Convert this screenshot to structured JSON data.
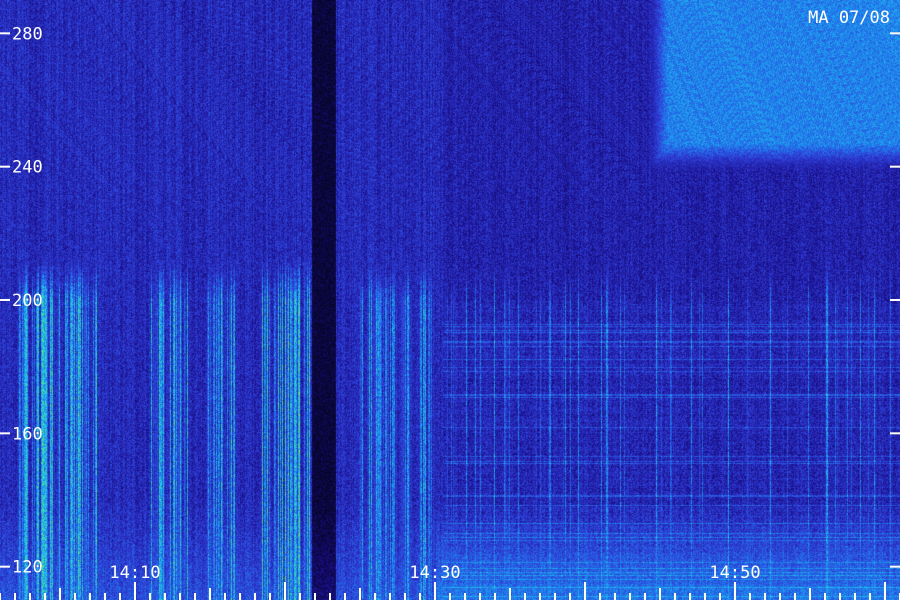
{
  "chart_data": {
    "type": "heatmap",
    "title": "MA 07/08",
    "y_ticks": [
      120,
      160,
      200,
      240,
      280
    ],
    "ylim": [
      110,
      290
    ],
    "x_ticks": [
      "14:10",
      "14:30",
      "14:50"
    ],
    "x_tick_minutes": [
      10,
      30,
      50
    ],
    "xlim_minutes": [
      1,
      61
    ],
    "colormap": [
      "#07052a",
      "#1a0f8c",
      "#2f3fd8",
      "#1e86ee",
      "#22c9ee",
      "#3ee68a",
      "#c8e23a"
    ],
    "tick_color": "#ffffff",
    "bursts": [
      {
        "start_min": 2.2,
        "end_min": 7.5,
        "intensity": 0.85
      },
      {
        "start_min": 11.0,
        "end_min": 13.5,
        "intensity": 0.8
      },
      {
        "start_min": 14.8,
        "end_min": 16.8,
        "intensity": 0.85
      },
      {
        "start_min": 18.4,
        "end_min": 21.6,
        "intensity": 0.9
      },
      {
        "start_min": 25.0,
        "end_min": 28.5,
        "intensity": 0.75
      },
      {
        "start_min": 29.0,
        "end_min": 29.9,
        "intensity": 0.9
      }
    ],
    "gap": {
      "start_min": 21.8,
      "end_min": 23.4
    },
    "bright_region": {
      "start_min": 43.5,
      "end_min": 61,
      "low": 235,
      "high": 290,
      "intensity": 0.6
    }
  }
}
